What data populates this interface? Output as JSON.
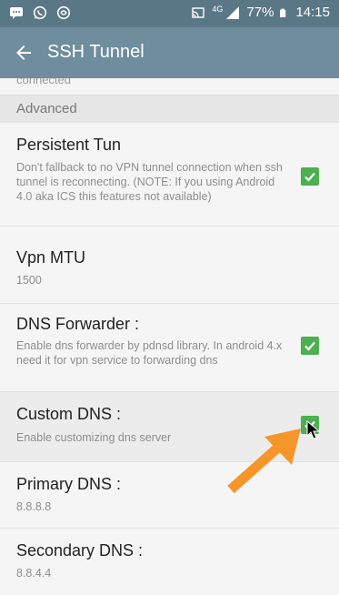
{
  "status_bar": {
    "network_type": "4G",
    "battery": "77%",
    "time": "14:15"
  },
  "app_bar": {
    "title": "SSH Tunnel"
  },
  "cut_off_text": "connected",
  "section_header": "Advanced",
  "preferences": [
    {
      "title": "Persistent Tun",
      "summary": "Don't fallback to no VPN tunnel connection when ssh tunnel is reconnecting. (NOTE: If you using Android 4.0 aka ICS this features not available)",
      "checked": true
    },
    {
      "title": "Vpn MTU",
      "summary": "1500"
    },
    {
      "title": "DNS Forwarder :",
      "summary": "Enable dns forwarder by pdnsd library. In android 4.x need it for vpn service to forwarding dns",
      "checked": true
    },
    {
      "title": "Custom DNS :",
      "summary": "Enable customizing dns server",
      "checked": true
    },
    {
      "title": "Primary DNS :",
      "summary": "8.8.8.8"
    },
    {
      "title": "Secondary DNS :",
      "summary": "8.8.4.4"
    }
  ],
  "colors": {
    "status_bar": "#5a7786",
    "app_bar": "#6e8d9d",
    "checkbox": "#4caf50",
    "annotation_arrow": "#f5962a"
  },
  "icons": {
    "status_left": [
      "messaging-icon",
      "whatsapp-icon",
      "app-icon"
    ],
    "status_right": [
      "cast-icon",
      "signal-icon",
      "battery-icon"
    ],
    "app_bar": "back-arrow-icon",
    "checkbox": "checkmark-icon",
    "annotation": "orange-arrow-icon"
  }
}
